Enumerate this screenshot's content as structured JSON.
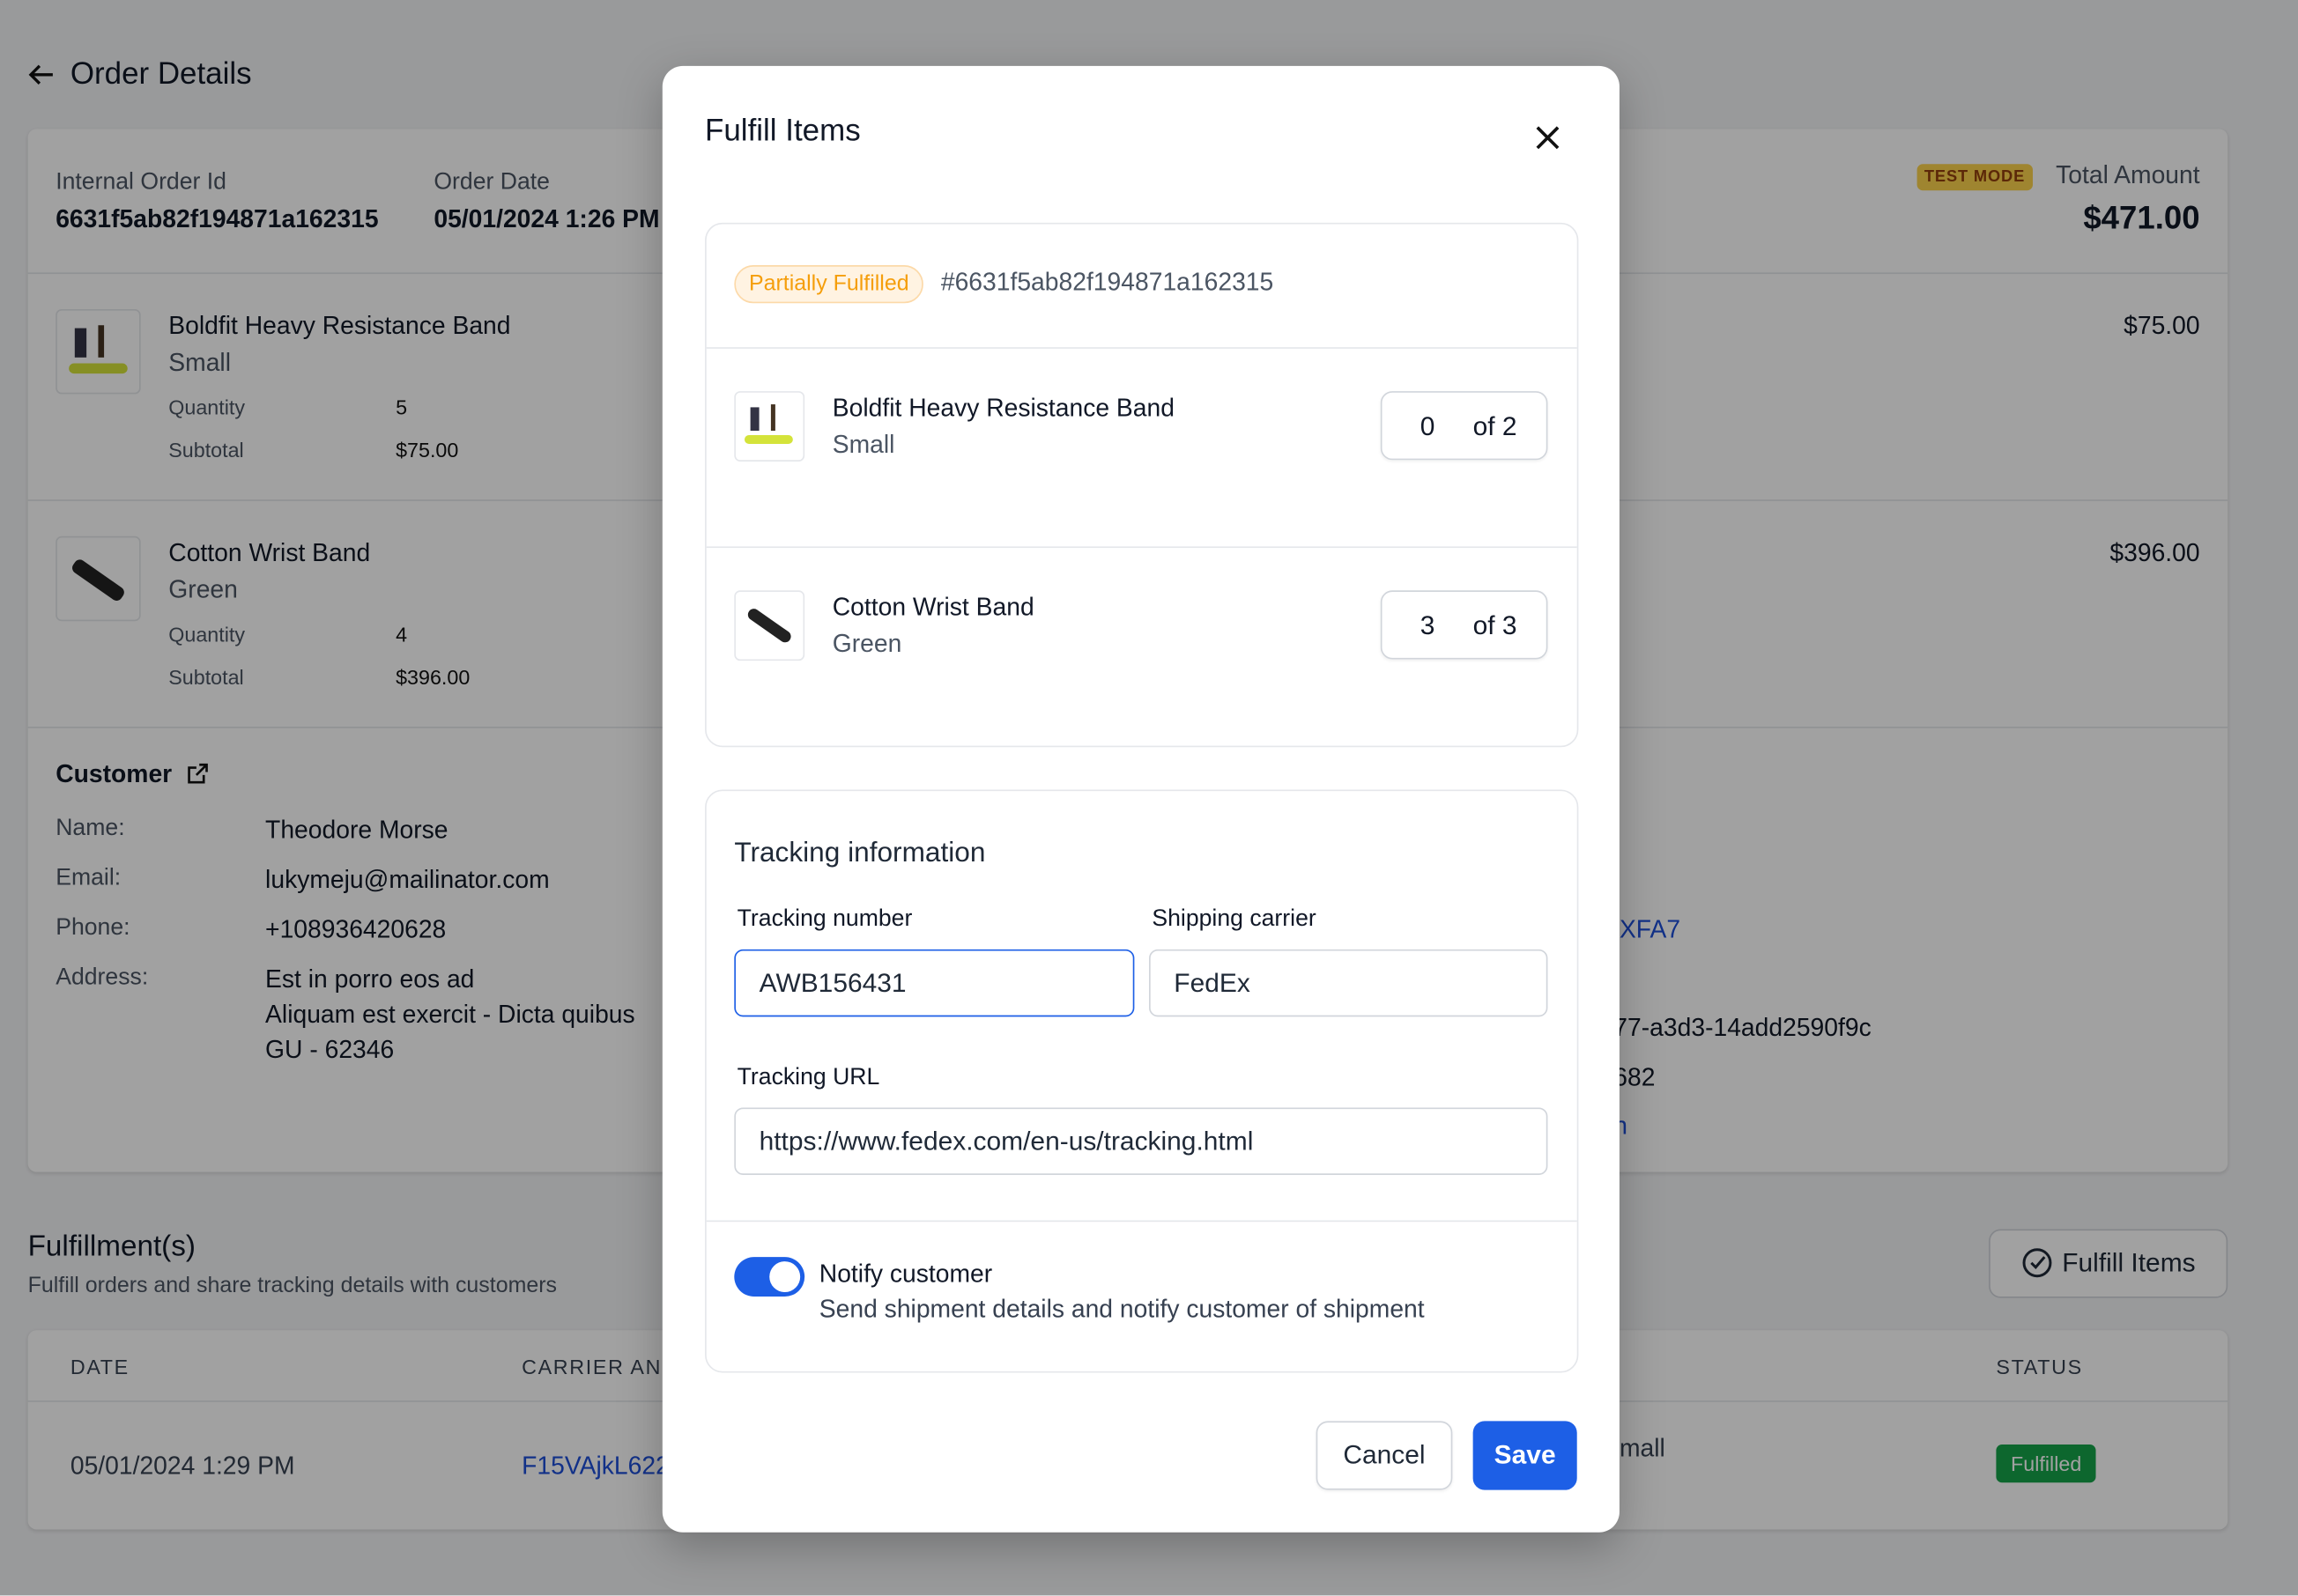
{
  "page": {
    "title": "Order Details",
    "back_icon": "arrow-left-icon",
    "order": {
      "internal_id_label": "Internal Order Id",
      "internal_id": "6631f5ab82f194871a162315",
      "date_label": "Order Date",
      "date": "05/01/2024 1:26 PM",
      "test_mode_badge": "TEST MODE",
      "total_label": "Total Amount",
      "total": "$471.00"
    },
    "items": [
      {
        "name": "Boldfit Heavy Resistance Band",
        "variant": "Small",
        "quantity_label": "Quantity",
        "quantity": "5",
        "subtotal_label": "Subtotal",
        "subtotal": "$75.00",
        "price": "$75.00"
      },
      {
        "name": "Cotton Wrist Band",
        "variant": "Green",
        "quantity_label": "Quantity",
        "quantity": "4",
        "subtotal_label": "Subtotal",
        "subtotal": "$396.00",
        "price": "$396.00"
      }
    ],
    "customer": {
      "title": "Customer",
      "name_label": "Name:",
      "name": "Theodore Morse",
      "email_label": "Email:",
      "email": "lukymeju@mailinator.com",
      "phone_label": "Phone:",
      "phone": "+108936420628",
      "address_label": "Address:",
      "address_lines": [
        "Est in porro eos ad",
        "Aliquam est exercit - Dicta quibus",
        "GU - 62346"
      ]
    },
    "right_fragments": [
      "XFA7",
      "77-a3d3-14add2590f9c",
      "682",
      "n"
    ],
    "fulfillments": {
      "title": "Fulfillment(s)",
      "subtitle": "Fulfill orders and share tracking details with customers",
      "fulfill_button": "Fulfill Items",
      "columns": [
        "DATE",
        "CARRIER AN",
        "STATUS"
      ],
      "row": {
        "date": "05/01/2024 1:29 PM",
        "tracking": "F15VAjkL622",
        "items_fragment": "mall",
        "status": "Fulfilled"
      }
    }
  },
  "modal": {
    "title": "Fulfill Items",
    "close_icon": "close-icon",
    "status_badge": "Partially Fulfilled",
    "order_ref": "#6631f5ab82f194871a162315",
    "items": [
      {
        "name": "Boldfit Heavy Resistance Band",
        "variant": "Small",
        "qty": "0",
        "of": "of 2"
      },
      {
        "name": "Cotton Wrist Band",
        "variant": "Green",
        "qty": "3",
        "of": "of 3"
      }
    ],
    "tracking": {
      "title": "Tracking information",
      "number_label": "Tracking number",
      "number": "AWB156431",
      "carrier_label": "Shipping carrier",
      "carrier": "FedEx",
      "url_label": "Tracking URL",
      "url": "https://www.fedex.com/en-us/tracking.html"
    },
    "notify": {
      "enabled": true,
      "label": "Notify customer",
      "description": "Send shipment details and notify customer of shipment"
    },
    "cancel": "Cancel",
    "save": "Save"
  },
  "colors": {
    "primary": "#1d5fe6",
    "partial_badge": "#f59e0b",
    "fulfilled_badge": "#16a34a",
    "test_mode": "#fcd34d"
  }
}
